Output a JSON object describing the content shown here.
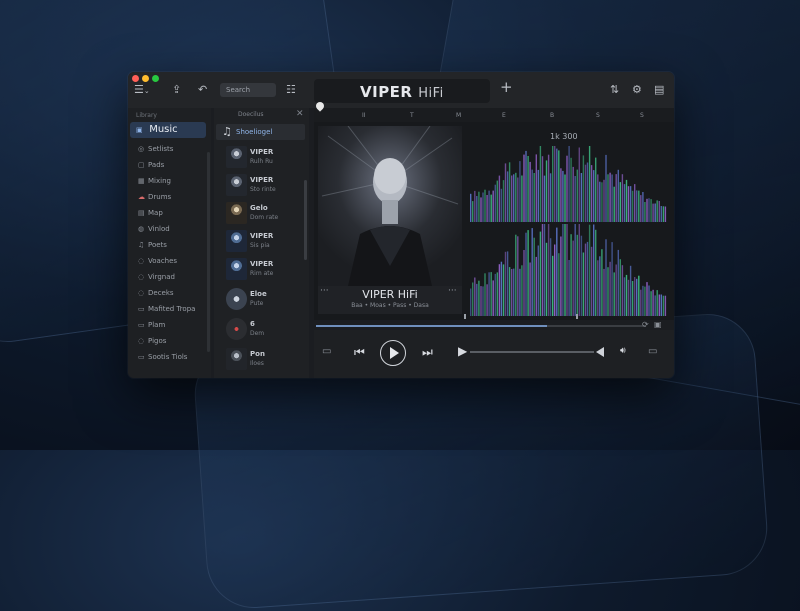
{
  "app": {
    "search_placeholder": "Search",
    "brand_main": "VIPER",
    "brand_sub": "HiFi"
  },
  "timeline_marks": [
    "II",
    "T",
    "M",
    "E",
    "B",
    "S",
    "S"
  ],
  "sidebar": {
    "top_label": "Library",
    "active_item": "Music",
    "items": [
      {
        "icon": "◎",
        "label": "Setlists"
      },
      {
        "icon": "▢",
        "label": "Pads"
      },
      {
        "icon": "▦",
        "label": "Mixing"
      },
      {
        "icon": "☁",
        "label": "Drums"
      },
      {
        "icon": "▤",
        "label": "Map"
      },
      {
        "icon": "◍",
        "label": "Vinlod"
      },
      {
        "icon": "♫",
        "label": "Poets"
      },
      {
        "icon": "◌",
        "label": "Voaches"
      },
      {
        "icon": "◌",
        "label": "Virgnad"
      },
      {
        "icon": "◌",
        "label": "Deceks"
      },
      {
        "icon": "▭",
        "label": "Mafited Tropa"
      },
      {
        "icon": "▭",
        "label": "Plam"
      },
      {
        "icon": "◌",
        "label": "Pigos"
      },
      {
        "icon": "▭",
        "label": "Sootis Tiols"
      }
    ]
  },
  "tracks": {
    "header": "Doecilus",
    "active_label": "Shoeliogel",
    "items": [
      {
        "title": "VIPER",
        "sub": "Rulh Ru"
      },
      {
        "title": "VIPER",
        "sub": "Sto rinte"
      },
      {
        "title": "Gelo",
        "sub": "Dom rate"
      },
      {
        "title": "VIPER",
        "sub": "Sis pia"
      },
      {
        "title": "VIPER",
        "sub": "Rim ate"
      },
      {
        "title": "Eloe",
        "sub": "Pute"
      },
      {
        "title": "6",
        "sub": "Dem"
      },
      {
        "title": "Pon",
        "sub": "Iloes"
      }
    ]
  },
  "now_playing": {
    "title": "VIPER HiFi",
    "subtitle": "Baa • Moas • Pass • Dasa",
    "spectrum_label": "1k 300",
    "progress": 0.7
  },
  "colors": {
    "accent": "#6f8fbd",
    "spectrum_blue": "#5b74c9",
    "spectrum_green": "#3fbf86",
    "spectrum_purple": "#9262c8"
  },
  "icons": [
    "app-menu-icon",
    "export-icon",
    "back-icon",
    "list-icon",
    "add-icon",
    "share-icon",
    "settings-icon",
    "window-icon",
    "close-icon",
    "prev-icon",
    "play-icon",
    "next-icon",
    "volume-icon",
    "repeat-icon",
    "queue-icon"
  ]
}
